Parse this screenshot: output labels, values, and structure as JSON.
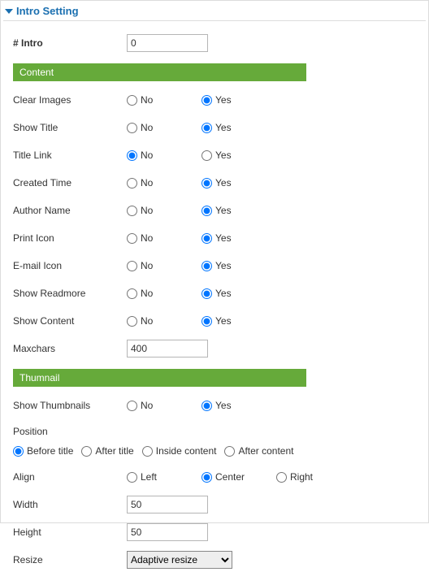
{
  "panel": {
    "title": "Intro Setting"
  },
  "intro": {
    "count_label": "# Intro",
    "count_value": "0"
  },
  "sections": {
    "content": "Content",
    "thumbnail": "Thumnail"
  },
  "opts": {
    "no": "No",
    "yes": "Yes"
  },
  "content": {
    "rows": [
      {
        "key": "clear_images",
        "label": "Clear Images",
        "value": "yes"
      },
      {
        "key": "show_title",
        "label": "Show Title",
        "value": "yes"
      },
      {
        "key": "title_link",
        "label": "Title Link",
        "value": "no"
      },
      {
        "key": "created_time",
        "label": "Created Time",
        "value": "yes"
      },
      {
        "key": "author_name",
        "label": "Author Name",
        "value": "yes"
      },
      {
        "key": "print_icon",
        "label": "Print Icon",
        "value": "yes"
      },
      {
        "key": "email_icon",
        "label": "E-mail Icon",
        "value": "yes"
      },
      {
        "key": "show_readmore",
        "label": "Show Readmore",
        "value": "yes"
      },
      {
        "key": "show_content",
        "label": "Show Content",
        "value": "yes"
      }
    ],
    "maxchars": {
      "label": "Maxchars",
      "value": "400"
    }
  },
  "thumb": {
    "show": {
      "label": "Show Thumbnails",
      "value": "yes"
    },
    "position": {
      "label": "Position",
      "options": [
        {
          "key": "before_title",
          "label": "Before title"
        },
        {
          "key": "after_title",
          "label": "After title"
        },
        {
          "key": "inside_content",
          "label": "Inside content"
        },
        {
          "key": "after_content",
          "label": "After content"
        }
      ],
      "value": "before_title"
    },
    "align": {
      "label": "Align",
      "options": [
        {
          "key": "left",
          "label": "Left"
        },
        {
          "key": "center",
          "label": "Center"
        },
        {
          "key": "right",
          "label": "Right"
        }
      ],
      "value": "center"
    },
    "width": {
      "label": "Width",
      "value": "50"
    },
    "height": {
      "label": "Height",
      "value": "50"
    },
    "resize": {
      "label": "Resize",
      "options": [
        "Adaptive resize"
      ],
      "value": "Adaptive resize"
    }
  }
}
